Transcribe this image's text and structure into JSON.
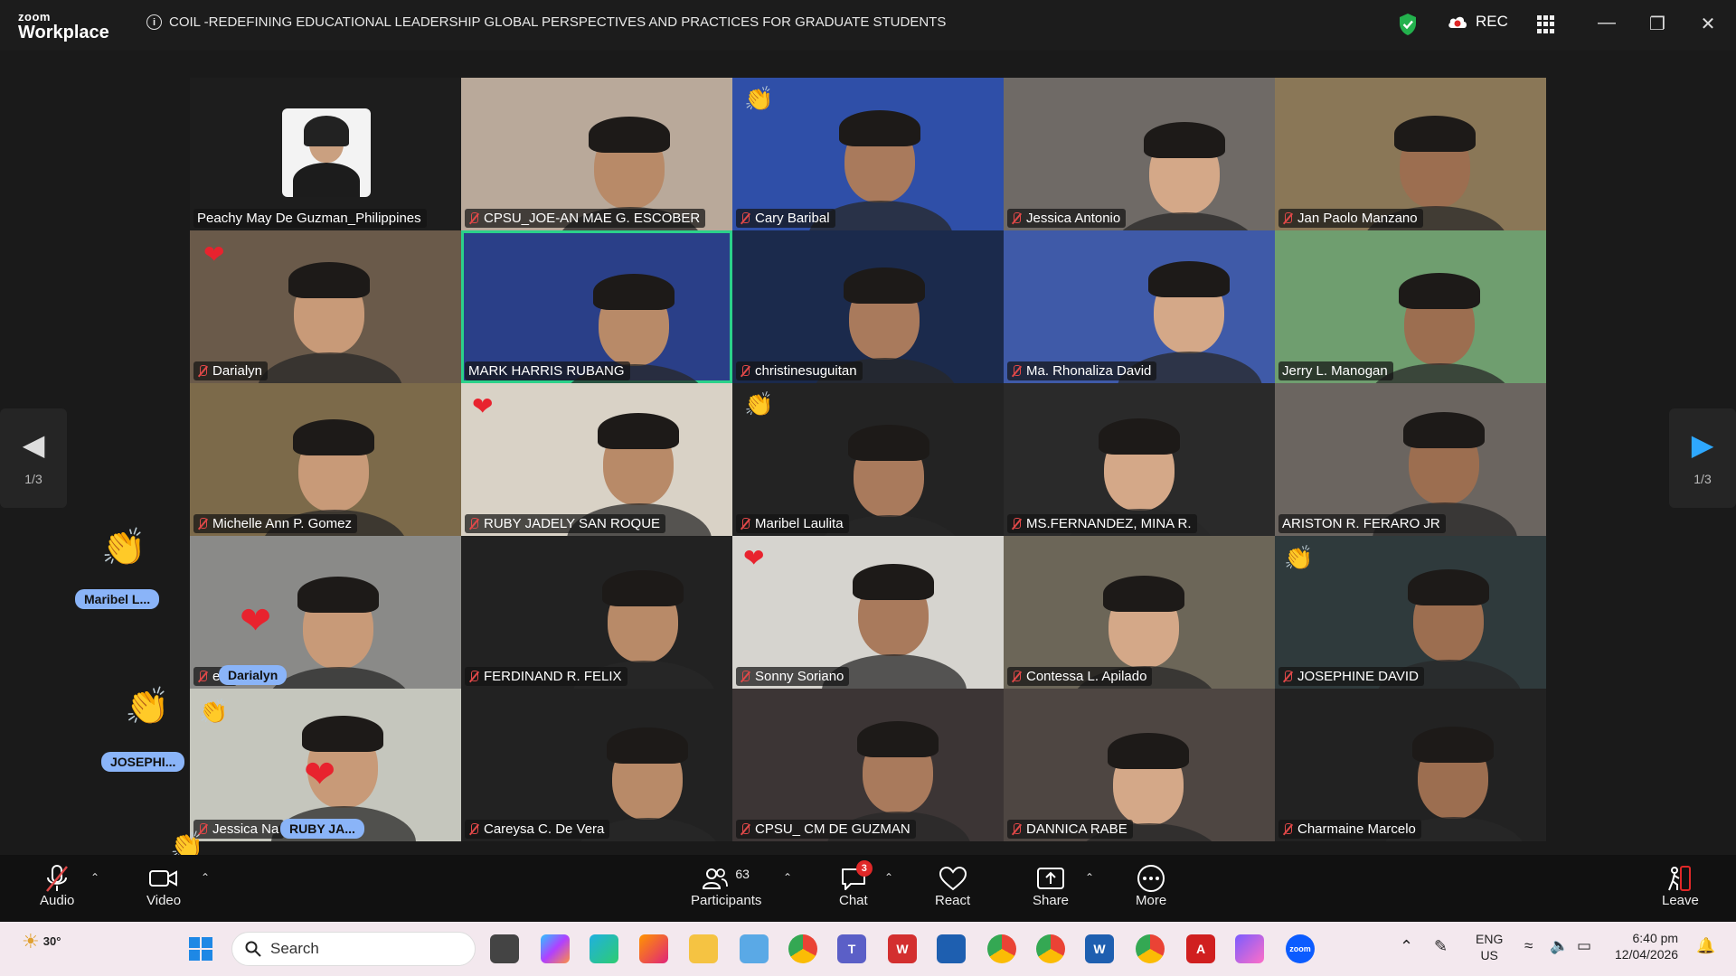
{
  "app": {
    "logo_top": "zoom",
    "logo_bottom": "Workplace"
  },
  "meeting": {
    "title": "COIL -REDEFINING EDUCATIONAL LEADERSHIP GLOBAL PERSPECTIVES AND PRACTICES FOR GRADUATE STUDENTS",
    "rec_label": "REC"
  },
  "participants": [
    {
      "name": "Peachy May De Guzman_Philippines",
      "bg": "#1d1d1d",
      "muted": false,
      "avatar": true
    },
    {
      "name": "CPSU_JOE-AN MAE G. ESCOBER",
      "bg": "#b9a99a",
      "muted": true
    },
    {
      "name": "Cary Baribal",
      "bg": "#2f4fa8",
      "muted": true
    },
    {
      "name": "Jessica Antonio",
      "bg": "#6f6a66",
      "muted": true
    },
    {
      "name": "Jan Paolo Manzano",
      "bg": "#8a7757",
      "muted": true
    },
    {
      "name": "Darialyn",
      "bg": "#6a5a4a",
      "muted": true
    },
    {
      "name": "MARK HARRIS RUBANG",
      "bg": "#2a3f88",
      "muted": false,
      "active": true
    },
    {
      "name": "christinesuguitan",
      "bg": "#1b2a4c",
      "muted": true
    },
    {
      "name": "Ma. Rhonaliza David",
      "bg": "#3f5aa8",
      "muted": true
    },
    {
      "name": "Jerry L. Manogan",
      "bg": "#6f9e6f",
      "muted": false
    },
    {
      "name": "Michelle Ann P. Gomez",
      "bg": "#7c6a4a",
      "muted": true
    },
    {
      "name": "RUBY JADELY SAN ROQUE",
      "bg": "#d9d2c6",
      "muted": true
    },
    {
      "name": "Maribel Laulita",
      "bg": "#232323",
      "muted": true
    },
    {
      "name": "MS.FERNANDEZ, MINA R.",
      "bg": "#2a2a2a",
      "muted": true
    },
    {
      "name": "ARISTON R. FERARO JR",
      "bg": "#6b6560",
      "muted": false
    },
    {
      "name": "ete",
      "bg": "#8a8a88",
      "muted": true
    },
    {
      "name": "FERDINAND R. FELIX",
      "bg": "#222",
      "muted": true
    },
    {
      "name": "Sonny Soriano",
      "bg": "#d6d4cf",
      "muted": true
    },
    {
      "name": "Contessa L. Apilado",
      "bg": "#6c6658",
      "muted": true
    },
    {
      "name": "JOSEPHINE DAVID",
      "bg": "#2f3a3c",
      "muted": true
    },
    {
      "name": "Jessica Na",
      "bg": "#c5c6bd",
      "muted": true
    },
    {
      "name": "Careysa C. De Vera",
      "bg": "#222",
      "muted": true
    },
    {
      "name": "CPSU_ CM DE GUZMAN",
      "bg": "#3c3535",
      "muted": true
    },
    {
      "name": "DANNICA RABE",
      "bg": "#4e4642",
      "muted": true
    },
    {
      "name": "Charmaine Marcelo",
      "bg": "#222",
      "muted": true
    }
  ],
  "overlay_names": {
    "darialyn": "Darialyn",
    "ruby": "RUBY JA...",
    "maribel": "Maribel  L...",
    "josephine": "JOSEPHI..."
  },
  "pagination": {
    "left": "1/3",
    "right": "1/3"
  },
  "toolbar": {
    "audio": "Audio",
    "video": "Video",
    "participants": "Participants",
    "participants_count": "63",
    "chat": "Chat",
    "chat_badge": "3",
    "react": "React",
    "share": "Share",
    "more": "More",
    "leave": "Leave"
  },
  "taskbar": {
    "weather": "30°",
    "search_placeholder": "Search",
    "lang": "ENG",
    "region": "US",
    "time": "6:40 pm",
    "date": "12/04/2026"
  },
  "colors": {
    "active_speaker": "#2bd18a",
    "accent": "#0b5cff",
    "reaction_heart": "#e8232e",
    "mute": "#e04848"
  }
}
